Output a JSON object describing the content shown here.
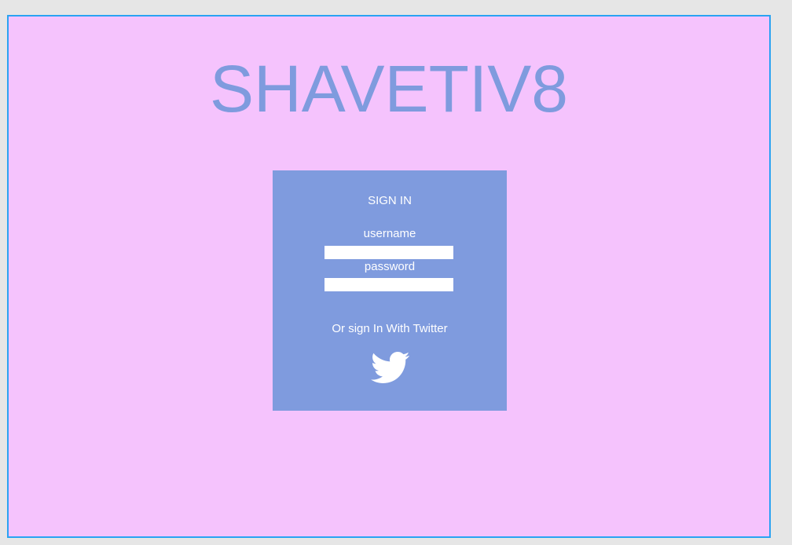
{
  "brand": {
    "title": "SHAVETIV8"
  },
  "signin": {
    "heading": "SIGN IN",
    "username_label": "username",
    "username_value": "",
    "password_label": "password",
    "password_value": "",
    "twitter_text": "Or sign In With Twitter",
    "twitter_icon": "twitter-bird-icon"
  },
  "colors": {
    "background": "#f5c3fd",
    "accent": "#7f9bde",
    "frame_border": "#2aa3f2",
    "outer_background": "#e6e6e6"
  }
}
